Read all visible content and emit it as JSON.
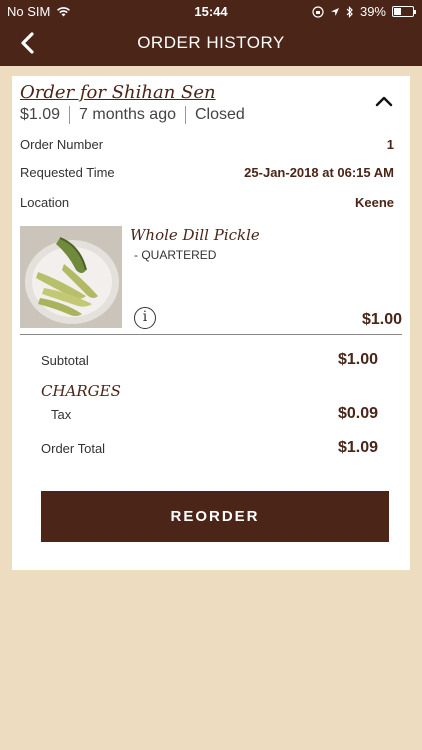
{
  "status_bar": {
    "carrier": "No SIM",
    "time": "15:44",
    "battery": "39%"
  },
  "header": {
    "title": "ORDER HISTORY"
  },
  "order": {
    "title": "Order for Shihan Sen",
    "total": "$1.09",
    "age": "7 months ago",
    "state": "Closed",
    "number_label": "Order Number",
    "number": "1",
    "requested_label": "Requested Time",
    "requested": "25-Jan-2018 at 06:15 AM",
    "location_label": "Location",
    "location": "Keene"
  },
  "items": [
    {
      "name": "Whole Dill Pickle",
      "modifier": "- QUARTERED",
      "price": "$1.00"
    }
  ],
  "summary": {
    "subtotal_label": "Subtotal",
    "subtotal": "$1.00",
    "charges_label": "CHARGES",
    "tax_label": "Tax",
    "tax": "$0.09",
    "total_label": "Order Total",
    "total": "$1.09"
  },
  "actions": {
    "reorder": "REORDER"
  },
  "colors": {
    "brand": "#4a2518",
    "background": "#eedcc0"
  }
}
